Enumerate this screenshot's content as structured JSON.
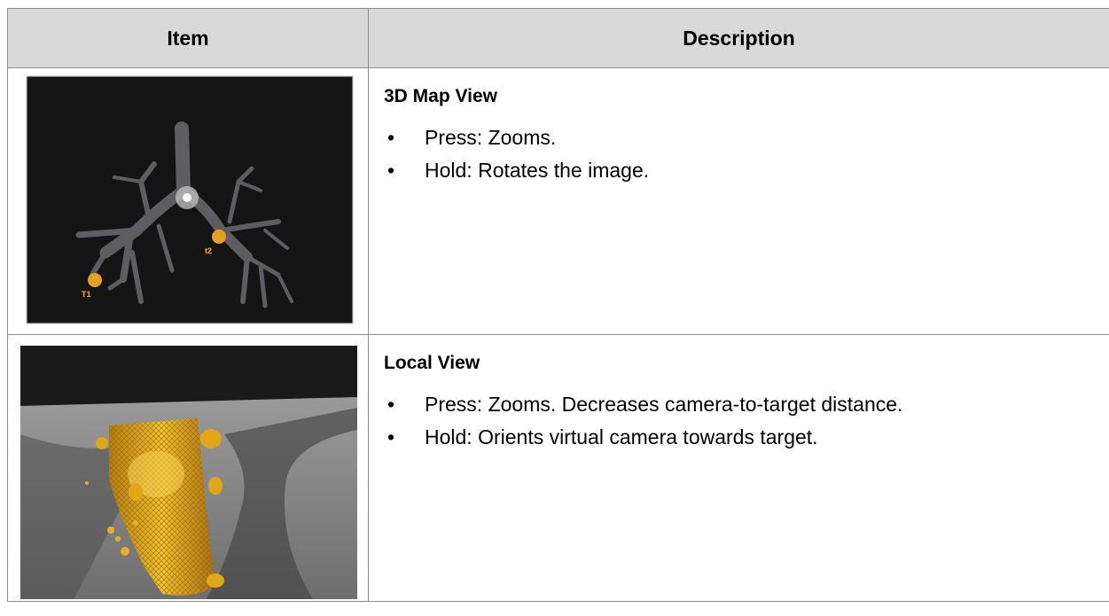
{
  "table": {
    "headers": {
      "item": "Item",
      "description": "Description"
    },
    "rows": [
      {
        "image_label": "3D Map View image",
        "title": "3D Map View",
        "bullets": [
          "Press: Zooms.",
          "Hold: Rotates the image."
        ],
        "markers": {
          "t1": "T1",
          "t2": "t2"
        }
      },
      {
        "image_label": "Local View image",
        "title": "Local View",
        "bullets": [
          "Press: Zooms. Decreases camera-to-target distance.",
          "Hold: Orients virtual camera towards target."
        ]
      }
    ]
  },
  "colors": {
    "header_bg": "#d9d9d9",
    "border": "#8c8c8c",
    "map_bg": "#141414",
    "airway": "#5e5e62",
    "target": "#e8a020",
    "mesh": "#e0a818"
  },
  "icons": {
    "bullet": "•"
  }
}
